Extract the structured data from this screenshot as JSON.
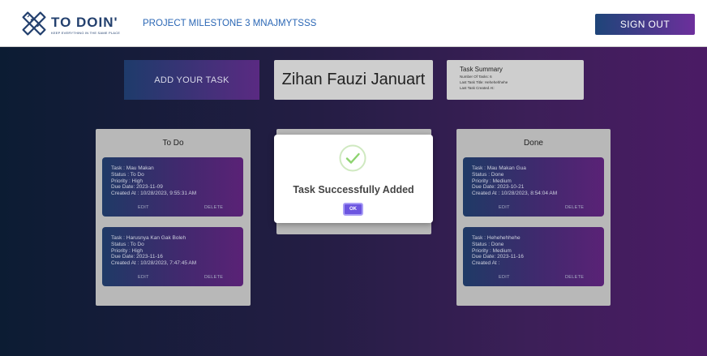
{
  "header": {
    "logo_text": "TO DOIN'",
    "logo_tagline": "KEEP EVERYTHING IN THE SAME PLACE",
    "project_title": "PROJECT MILESTONE 3 MNAJMYTSSS",
    "sign_out_label": "SIGN OUT"
  },
  "top": {
    "add_task_label": "ADD YOUR TASK",
    "user_name": "Zihan Fauzi Januart",
    "summary": {
      "title": "Task Summary",
      "lines": [
        "Number Of Tasks: 6",
        "Last Task Title: Hehehehhehe",
        "Last Task Created At:"
      ]
    }
  },
  "columns": {
    "todo": {
      "title": "To Do",
      "cards": [
        {
          "lines": [
            "Task : Mau Makan",
            "Status : To Do",
            "Priority : High",
            "Due Date: 2023-11-09",
            "Created At : 10/28/2023, 9:55:31 AM"
          ],
          "edit_label": "EDIT",
          "delete_label": "DELETE"
        },
        {
          "lines": [
            "Task : Harusnya Kan Gak Boleh",
            "Status : To Do",
            "Priority : High",
            "Due Date: 2023-11-16",
            "Created At : 10/28/2023, 7:47:45 AM"
          ],
          "edit_label": "EDIT",
          "delete_label": "DELETE"
        }
      ]
    },
    "done": {
      "title": "Done",
      "cards": [
        {
          "lines": [
            "Task : Mau Makan Gua",
            "Status : Done",
            "Priority : Medium",
            "Due Date: 2023-10-21",
            "Created At : 10/28/2023, 8:54:04 AM"
          ],
          "edit_label": "EDIT",
          "delete_label": "DELETE"
        },
        {
          "lines": [
            "Task : Hehehehhehe",
            "Status : Done",
            "Priority : Medium",
            "Due Date: 2023-11-16",
            "Created At :"
          ],
          "edit_label": "EDIT",
          "delete_label": "DELETE"
        }
      ]
    }
  },
  "modal": {
    "icon": "check-circle-icon",
    "title": "Task Successfully Added",
    "ok_label": "OK"
  },
  "colors": {
    "accent_blue": "#1e4579",
    "accent_purple": "#6d2f9c",
    "success_green": "#8dd36f",
    "ok_button": "#6c55e0"
  }
}
